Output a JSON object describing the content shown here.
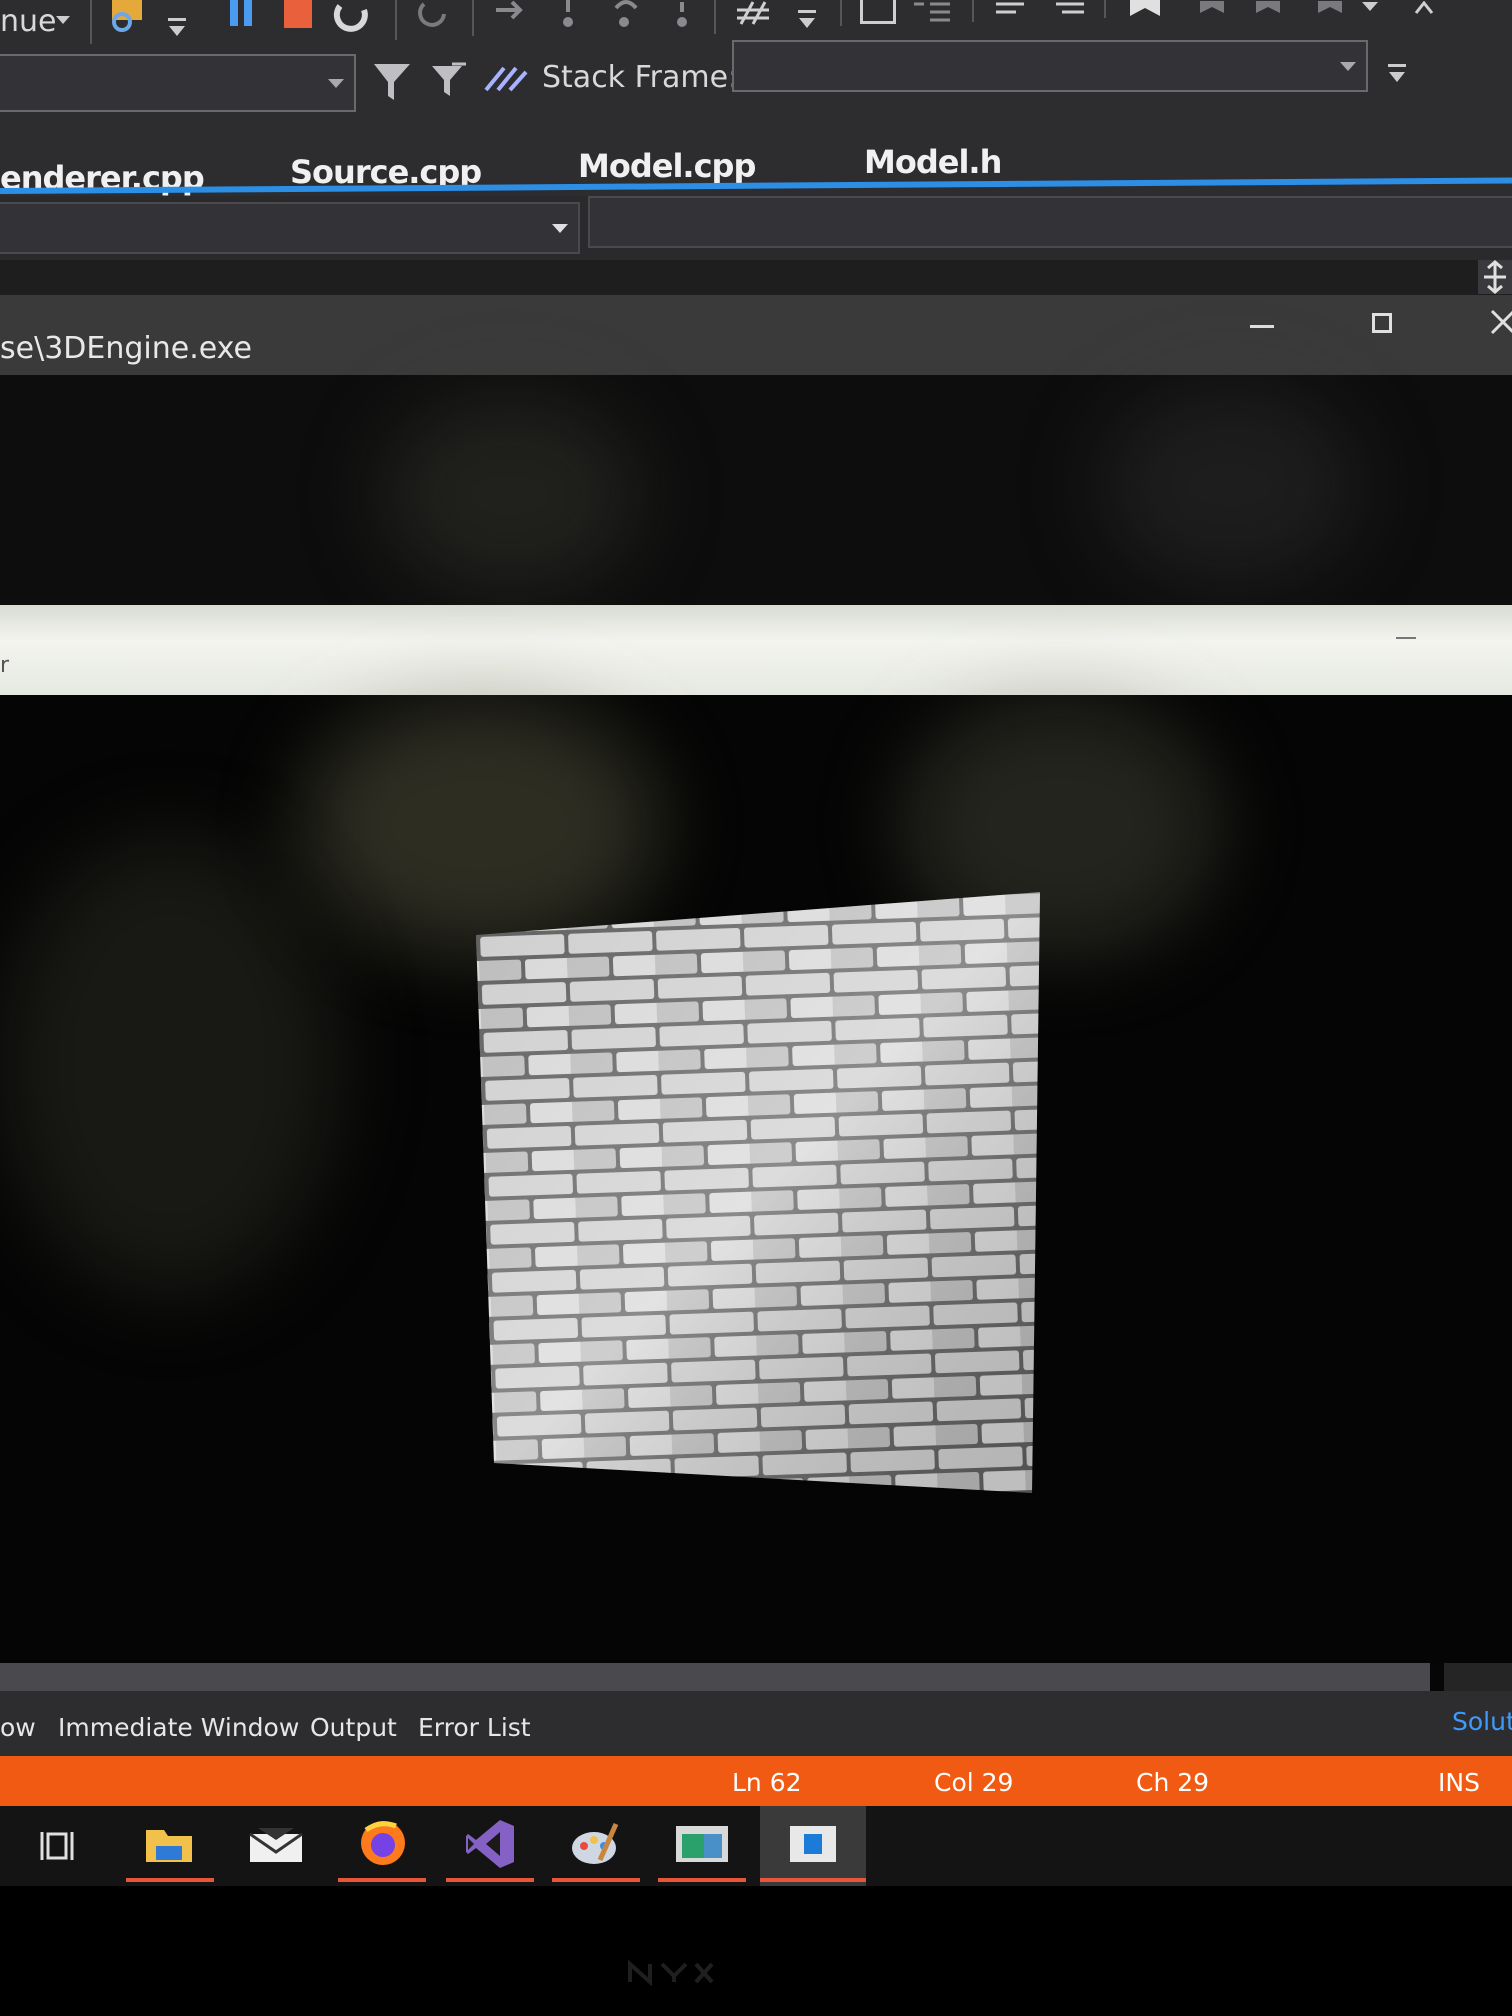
{
  "toolbar": {
    "continue_label": "nue",
    "stack_frame_label": "Stack Frame:",
    "stack_frame_value": ""
  },
  "tabs": [
    {
      "label": "enderer.cpp"
    },
    {
      "label": "Source.cpp"
    },
    {
      "label": "Model.cpp"
    },
    {
      "label": "Model.h"
    }
  ],
  "console_window": {
    "title": "se\\3DEngine.exe"
  },
  "render_window": {
    "title": "r",
    "texture": "brick-wall"
  },
  "bottom_tabs": {
    "items": [
      {
        "label": "ow"
      },
      {
        "label": "Immediate Window"
      },
      {
        "label": "Output"
      },
      {
        "label": "Error List"
      }
    ],
    "solution_label": "Solut"
  },
  "status_bar": {
    "line": "Ln 62",
    "column": "Col 29",
    "char": "Ch 29",
    "mode": "INS",
    "color": "#f05a13"
  },
  "taskbar": {
    "apps": [
      {
        "icon": "task-view-icon"
      },
      {
        "icon": "file-explorer-icon"
      },
      {
        "icon": "mail-icon"
      },
      {
        "icon": "firefox-icon"
      },
      {
        "icon": "visual-studio-icon"
      },
      {
        "icon": "paint-icon"
      },
      {
        "icon": "app-window-icon"
      },
      {
        "icon": "active-app-icon"
      }
    ]
  },
  "colors": {
    "accent_blue": "#2c8fe6",
    "status_orange": "#f05a13"
  }
}
